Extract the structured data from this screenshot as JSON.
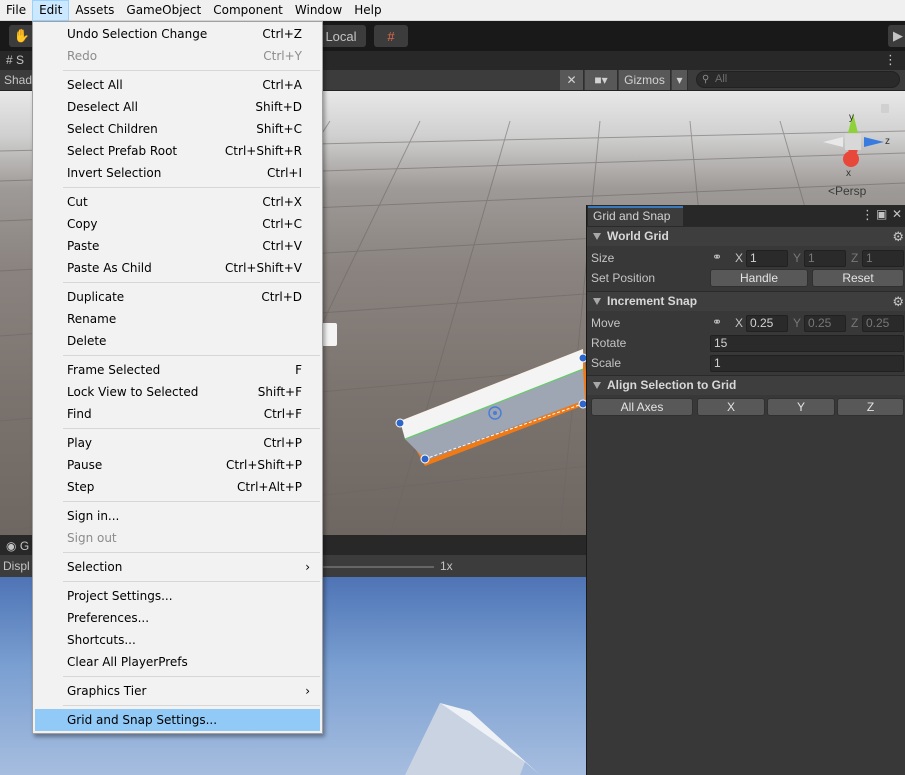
{
  "menubar": {
    "items": [
      "File",
      "Edit",
      "Assets",
      "GameObject",
      "Component",
      "Window",
      "Help"
    ],
    "active": "Edit"
  },
  "toolbar": {
    "pivot_rotation": "Local"
  },
  "scene": {
    "tab_fragment": "S",
    "shading_fragment": "Shad",
    "gizmos_label": "Gizmos",
    "search_placeholder": "All",
    "projection_label": "<Persp",
    "gizmo_axes": {
      "y": "y",
      "z": "z",
      "x": "x"
    }
  },
  "game": {
    "tab_fragment": "G",
    "display_fragment": "Displ",
    "scale_value": "1x"
  },
  "edit_menu": {
    "items": [
      {
        "label": "Undo Selection Change",
        "shortcut": "Ctrl+Z"
      },
      {
        "label": "Redo",
        "shortcut": "Ctrl+Y",
        "disabled": true
      },
      {
        "label": "Select All",
        "shortcut": "Ctrl+A"
      },
      {
        "label": "Deselect All",
        "shortcut": "Shift+D"
      },
      {
        "label": "Select Children",
        "shortcut": "Shift+C"
      },
      {
        "label": "Select Prefab Root",
        "shortcut": "Ctrl+Shift+R"
      },
      {
        "label": "Invert Selection",
        "shortcut": "Ctrl+I"
      },
      {
        "label": "Cut",
        "shortcut": "Ctrl+X"
      },
      {
        "label": "Copy",
        "shortcut": "Ctrl+C"
      },
      {
        "label": "Paste",
        "shortcut": "Ctrl+V"
      },
      {
        "label": "Paste As Child",
        "shortcut": "Ctrl+Shift+V"
      },
      {
        "label": "Duplicate",
        "shortcut": "Ctrl+D"
      },
      {
        "label": "Rename",
        "shortcut": ""
      },
      {
        "label": "Delete",
        "shortcut": ""
      },
      {
        "label": "Frame Selected",
        "shortcut": "F"
      },
      {
        "label": "Lock View to Selected",
        "shortcut": "Shift+F"
      },
      {
        "label": "Find",
        "shortcut": "Ctrl+F"
      },
      {
        "label": "Play",
        "shortcut": "Ctrl+P"
      },
      {
        "label": "Pause",
        "shortcut": "Ctrl+Shift+P"
      },
      {
        "label": "Step",
        "shortcut": "Ctrl+Alt+P"
      },
      {
        "label": "Sign in...",
        "shortcut": ""
      },
      {
        "label": "Sign out",
        "shortcut": "",
        "disabled": true
      },
      {
        "label": "Selection",
        "shortcut": "",
        "submenu": true
      },
      {
        "label": "Project Settings...",
        "shortcut": ""
      },
      {
        "label": "Preferences...",
        "shortcut": ""
      },
      {
        "label": "Shortcuts...",
        "shortcut": ""
      },
      {
        "label": "Clear All PlayerPrefs",
        "shortcut": ""
      },
      {
        "label": "Graphics Tier",
        "shortcut": "",
        "submenu": true
      },
      {
        "label": "Grid and Snap Settings...",
        "shortcut": "",
        "highlighted": true
      }
    ]
  },
  "grid_snap": {
    "tab_title": "Grid and Snap",
    "world_grid": {
      "header": "World Grid",
      "size_label": "Size",
      "size_x": "1",
      "size_y": "1",
      "size_z": "1",
      "set_position_label": "Set Position",
      "handle_button": "Handle",
      "reset_button": "Reset"
    },
    "increment_snap": {
      "header": "Increment Snap",
      "move_label": "Move",
      "move_x": "0.25",
      "move_y": "0.25",
      "move_z": "0.25",
      "rotate_label": "Rotate",
      "rotate_value": "15",
      "scale_label": "Scale",
      "scale_value": "1"
    },
    "align": {
      "header": "Align Selection to Grid",
      "all_axes": "All Axes",
      "x": "X",
      "y": "Y",
      "z": "Z"
    },
    "axis_labels": {
      "x": "X",
      "y": "Y",
      "z": "Z"
    }
  },
  "colors": {
    "selection_outline": "#f07a16",
    "menu_highlight": "#91c9f7",
    "tab_accent": "#3a79bb"
  }
}
